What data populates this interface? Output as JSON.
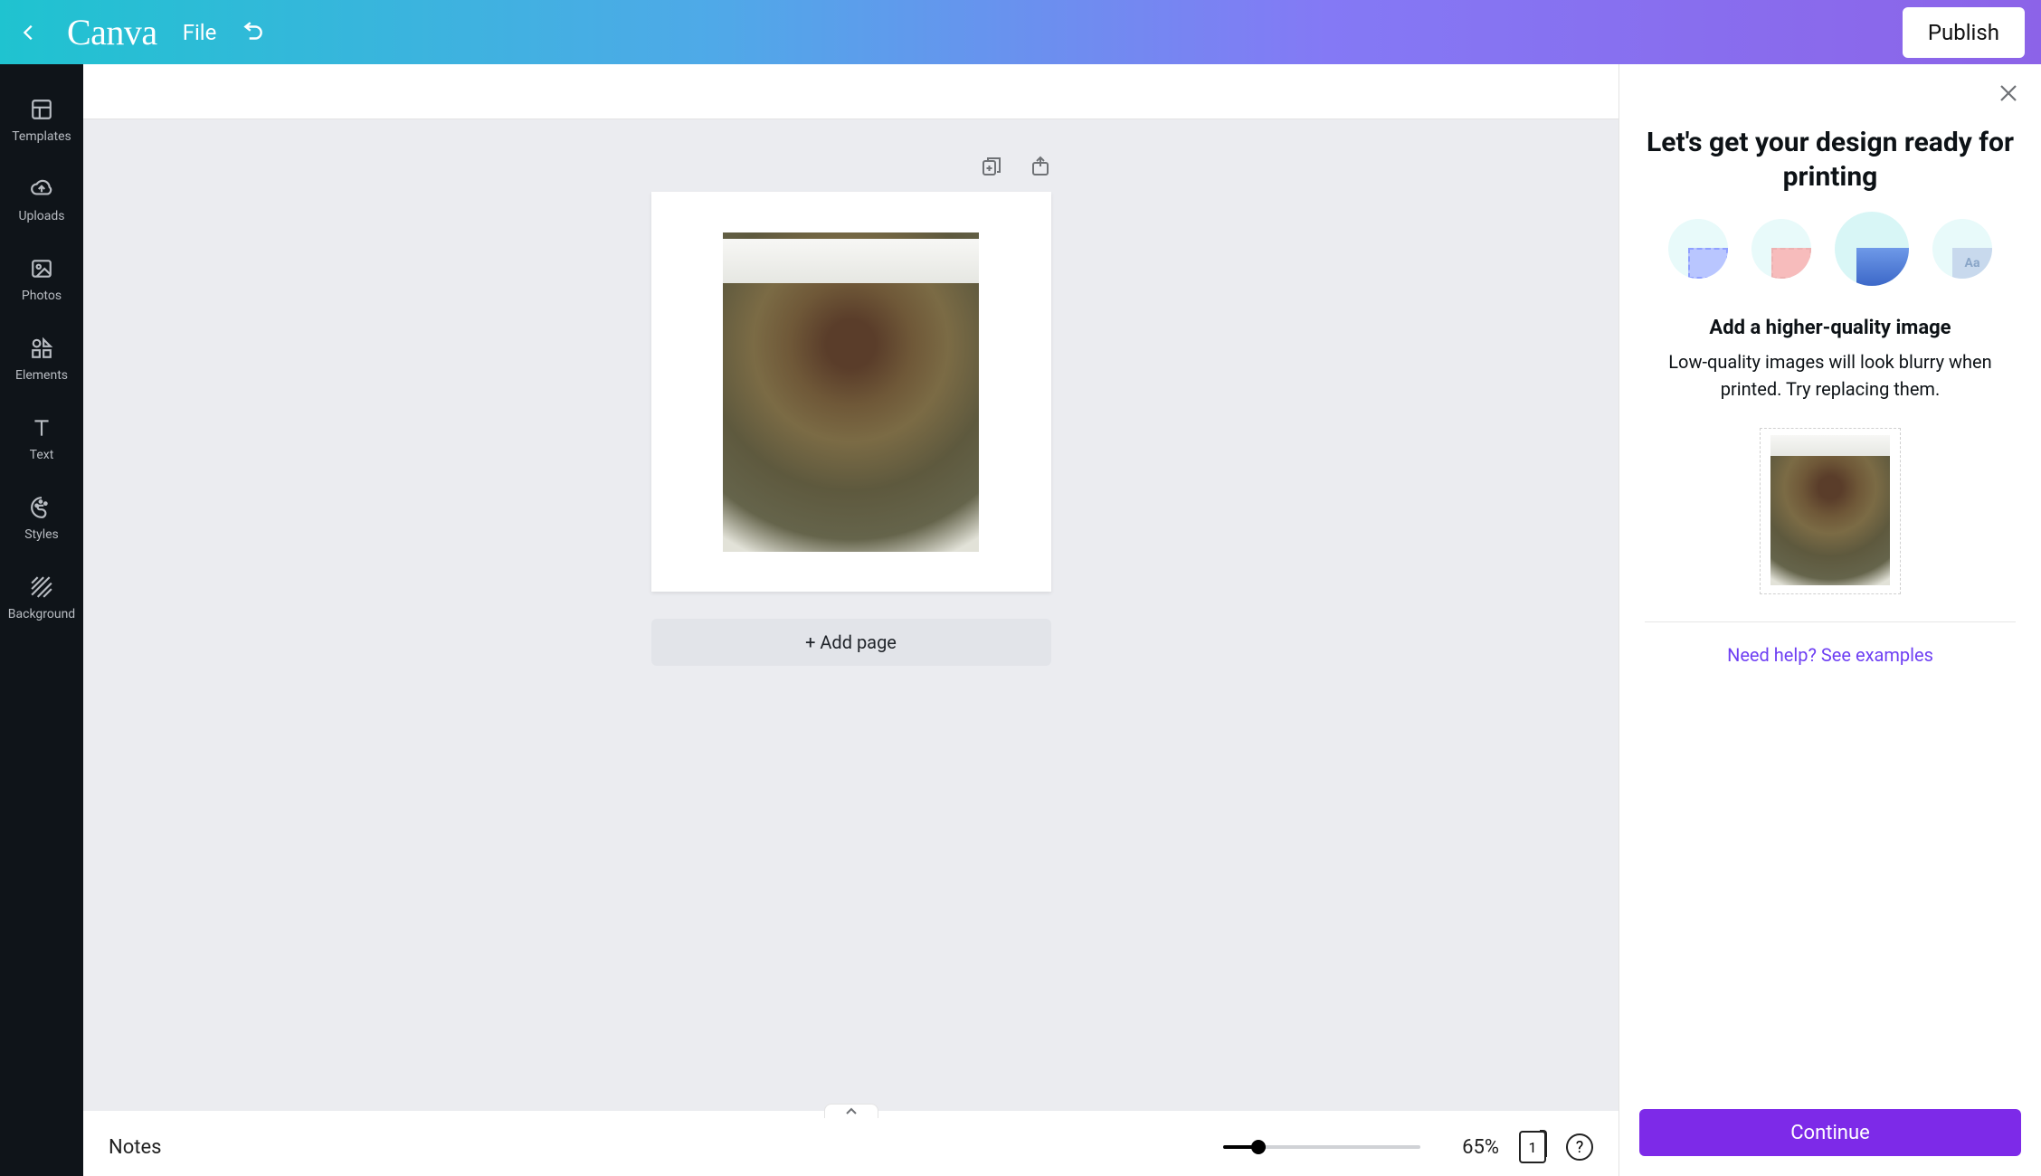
{
  "header": {
    "logo": "Canva",
    "file_label": "File",
    "publish_label": "Publish"
  },
  "sidebar": {
    "items": [
      {
        "label": "Templates"
      },
      {
        "label": "Uploads"
      },
      {
        "label": "Photos"
      },
      {
        "label": "Elements"
      },
      {
        "label": "Text"
      },
      {
        "label": "Styles"
      },
      {
        "label": "Background"
      }
    ]
  },
  "canvas": {
    "add_page_label": "+ Add page"
  },
  "bottom": {
    "notes_label": "Notes",
    "zoom_label": "65%",
    "page_count": "1",
    "help_label": "?"
  },
  "panel": {
    "title": "Let's get your design ready for printing",
    "subheading": "Add a higher-quality image",
    "description": "Low-quality images will look blurry when printed. Try replacing them.",
    "step4_text": "Aa",
    "help_link": "Need help? See examples",
    "continue_label": "Continue"
  }
}
